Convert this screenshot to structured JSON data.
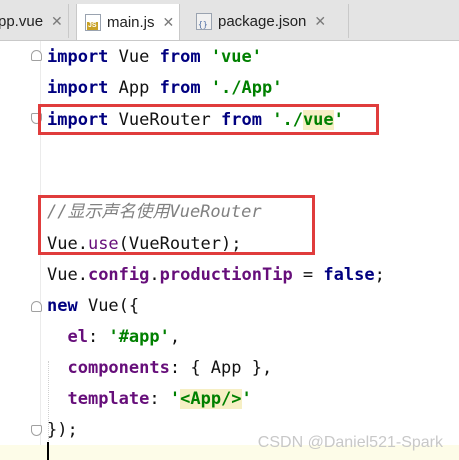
{
  "tabs": [
    {
      "label": "pp.vue",
      "close": "✕"
    },
    {
      "label": "main.js",
      "close": "✕",
      "active": true
    },
    {
      "label": "package.json",
      "close": "✕"
    }
  ],
  "code": {
    "l1": {
      "kw": "import",
      "name": " Vue ",
      "from": "from",
      "sp": " ",
      "str": "'vue'"
    },
    "l2": {
      "kw": "import",
      "name": " App ",
      "from": "from",
      "sp": " ",
      "str": "'./App'"
    },
    "l3": {
      "kw": "import",
      "name": " VueRouter ",
      "from": "from",
      "sp": " ",
      "str_a": "'./",
      "str_b": "vue",
      "str_c": "'"
    },
    "l4": {
      "comment": "//显示声名使用VueRouter"
    },
    "l5": {
      "obj": "Vue.",
      "method": "use",
      "rest": "(VueRouter);"
    },
    "l6": {
      "obj": "Vue.",
      "p1": "config",
      "dot": ".",
      "p2": "productionTip",
      "eq": " = ",
      "kw": "false",
      "end": ";"
    },
    "l7": {
      "kw": "new",
      "rest": " Vue({"
    },
    "l8": {
      "indent": "  ",
      "prop": "el",
      "colon": ": ",
      "str": "'#app'",
      "end": ","
    },
    "l9": {
      "indent": "  ",
      "prop": "components",
      "rest": ": { App },"
    },
    "l10": {
      "indent": "  ",
      "prop": "template",
      "colon": ": ",
      "str_a": "'",
      "tag": "<App/>",
      "str_b": "'"
    },
    "l11": {
      "text": "});"
    }
  },
  "watermark": "CSDN @Daniel521-Spark",
  "colors": {
    "keyword": "#000080",
    "string": "#008000",
    "property": "#660e7a",
    "comment": "#808080",
    "highlight_box": "#e03c3c"
  }
}
